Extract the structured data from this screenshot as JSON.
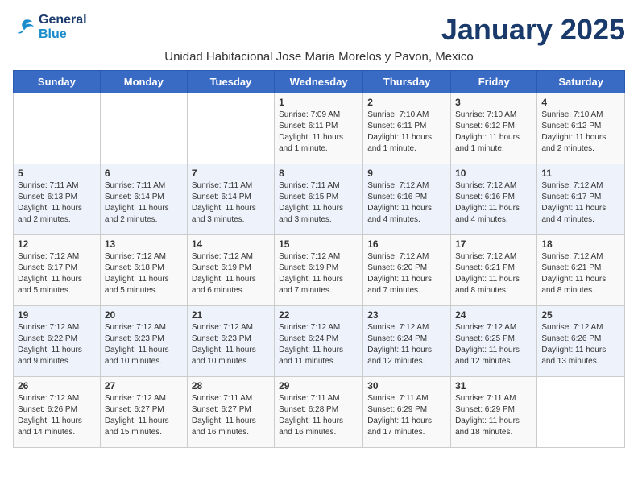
{
  "logo": {
    "line1": "General",
    "line2": "Blue"
  },
  "title": "January 2025",
  "subtitle": "Unidad Habitacional Jose Maria Morelos y Pavon, Mexico",
  "days_of_week": [
    "Sunday",
    "Monday",
    "Tuesday",
    "Wednesday",
    "Thursday",
    "Friday",
    "Saturday"
  ],
  "weeks": [
    [
      {
        "day": "",
        "info": ""
      },
      {
        "day": "",
        "info": ""
      },
      {
        "day": "",
        "info": ""
      },
      {
        "day": "1",
        "info": "Sunrise: 7:09 AM\nSunset: 6:11 PM\nDaylight: 11 hours\nand 1 minute."
      },
      {
        "day": "2",
        "info": "Sunrise: 7:10 AM\nSunset: 6:11 PM\nDaylight: 11 hours\nand 1 minute."
      },
      {
        "day": "3",
        "info": "Sunrise: 7:10 AM\nSunset: 6:12 PM\nDaylight: 11 hours\nand 1 minute."
      },
      {
        "day": "4",
        "info": "Sunrise: 7:10 AM\nSunset: 6:12 PM\nDaylight: 11 hours\nand 2 minutes."
      }
    ],
    [
      {
        "day": "5",
        "info": "Sunrise: 7:11 AM\nSunset: 6:13 PM\nDaylight: 11 hours\nand 2 minutes."
      },
      {
        "day": "6",
        "info": "Sunrise: 7:11 AM\nSunset: 6:14 PM\nDaylight: 11 hours\nand 2 minutes."
      },
      {
        "day": "7",
        "info": "Sunrise: 7:11 AM\nSunset: 6:14 PM\nDaylight: 11 hours\nand 3 minutes."
      },
      {
        "day": "8",
        "info": "Sunrise: 7:11 AM\nSunset: 6:15 PM\nDaylight: 11 hours\nand 3 minutes."
      },
      {
        "day": "9",
        "info": "Sunrise: 7:12 AM\nSunset: 6:16 PM\nDaylight: 11 hours\nand 4 minutes."
      },
      {
        "day": "10",
        "info": "Sunrise: 7:12 AM\nSunset: 6:16 PM\nDaylight: 11 hours\nand 4 minutes."
      },
      {
        "day": "11",
        "info": "Sunrise: 7:12 AM\nSunset: 6:17 PM\nDaylight: 11 hours\nand 4 minutes."
      }
    ],
    [
      {
        "day": "12",
        "info": "Sunrise: 7:12 AM\nSunset: 6:17 PM\nDaylight: 11 hours\nand 5 minutes."
      },
      {
        "day": "13",
        "info": "Sunrise: 7:12 AM\nSunset: 6:18 PM\nDaylight: 11 hours\nand 5 minutes."
      },
      {
        "day": "14",
        "info": "Sunrise: 7:12 AM\nSunset: 6:19 PM\nDaylight: 11 hours\nand 6 minutes."
      },
      {
        "day": "15",
        "info": "Sunrise: 7:12 AM\nSunset: 6:19 PM\nDaylight: 11 hours\nand 7 minutes."
      },
      {
        "day": "16",
        "info": "Sunrise: 7:12 AM\nSunset: 6:20 PM\nDaylight: 11 hours\nand 7 minutes."
      },
      {
        "day": "17",
        "info": "Sunrise: 7:12 AM\nSunset: 6:21 PM\nDaylight: 11 hours\nand 8 minutes."
      },
      {
        "day": "18",
        "info": "Sunrise: 7:12 AM\nSunset: 6:21 PM\nDaylight: 11 hours\nand 8 minutes."
      }
    ],
    [
      {
        "day": "19",
        "info": "Sunrise: 7:12 AM\nSunset: 6:22 PM\nDaylight: 11 hours\nand 9 minutes."
      },
      {
        "day": "20",
        "info": "Sunrise: 7:12 AM\nSunset: 6:23 PM\nDaylight: 11 hours\nand 10 minutes."
      },
      {
        "day": "21",
        "info": "Sunrise: 7:12 AM\nSunset: 6:23 PM\nDaylight: 11 hours\nand 10 minutes."
      },
      {
        "day": "22",
        "info": "Sunrise: 7:12 AM\nSunset: 6:24 PM\nDaylight: 11 hours\nand 11 minutes."
      },
      {
        "day": "23",
        "info": "Sunrise: 7:12 AM\nSunset: 6:24 PM\nDaylight: 11 hours\nand 12 minutes."
      },
      {
        "day": "24",
        "info": "Sunrise: 7:12 AM\nSunset: 6:25 PM\nDaylight: 11 hours\nand 12 minutes."
      },
      {
        "day": "25",
        "info": "Sunrise: 7:12 AM\nSunset: 6:26 PM\nDaylight: 11 hours\nand 13 minutes."
      }
    ],
    [
      {
        "day": "26",
        "info": "Sunrise: 7:12 AM\nSunset: 6:26 PM\nDaylight: 11 hours\nand 14 minutes."
      },
      {
        "day": "27",
        "info": "Sunrise: 7:12 AM\nSunset: 6:27 PM\nDaylight: 11 hours\nand 15 minutes."
      },
      {
        "day": "28",
        "info": "Sunrise: 7:11 AM\nSunset: 6:27 PM\nDaylight: 11 hours\nand 16 minutes."
      },
      {
        "day": "29",
        "info": "Sunrise: 7:11 AM\nSunset: 6:28 PM\nDaylight: 11 hours\nand 16 minutes."
      },
      {
        "day": "30",
        "info": "Sunrise: 7:11 AM\nSunset: 6:29 PM\nDaylight: 11 hours\nand 17 minutes."
      },
      {
        "day": "31",
        "info": "Sunrise: 7:11 AM\nSunset: 6:29 PM\nDaylight: 11 hours\nand 18 minutes."
      },
      {
        "day": "",
        "info": ""
      }
    ]
  ]
}
